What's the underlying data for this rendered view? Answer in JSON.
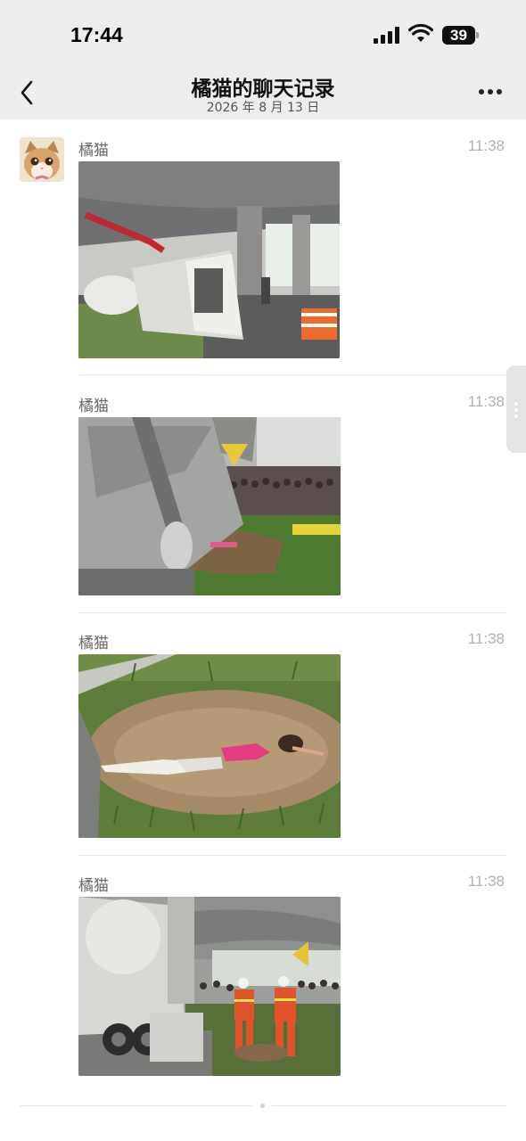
{
  "status_bar": {
    "time": "17:44",
    "battery": "39"
  },
  "header": {
    "title": "橘猫的聊天记录",
    "subtitle": "2026 年 8 月 13 日"
  },
  "messages": [
    {
      "sender": "橘猫",
      "time": "11:38",
      "image": "overturned-cement-truck-under-overpass"
    },
    {
      "sender": "橘猫",
      "time": "11:38",
      "image": "truck-wreck-with-crowd"
    },
    {
      "sender": "橘猫",
      "time": "11:38",
      "image": "victim-on-grass"
    },
    {
      "sender": "橘猫",
      "time": "11:38",
      "image": "firefighters-at-scene"
    }
  ],
  "colors": {
    "bar_bg": "#ededed",
    "page_bg": "#ffffff",
    "name_text": "#666666",
    "time_text": "#b0b0b0"
  },
  "icons": [
    "back-icon",
    "more-icon",
    "signal-icon",
    "wifi-icon",
    "battery-icon",
    "avatar-cat"
  ]
}
